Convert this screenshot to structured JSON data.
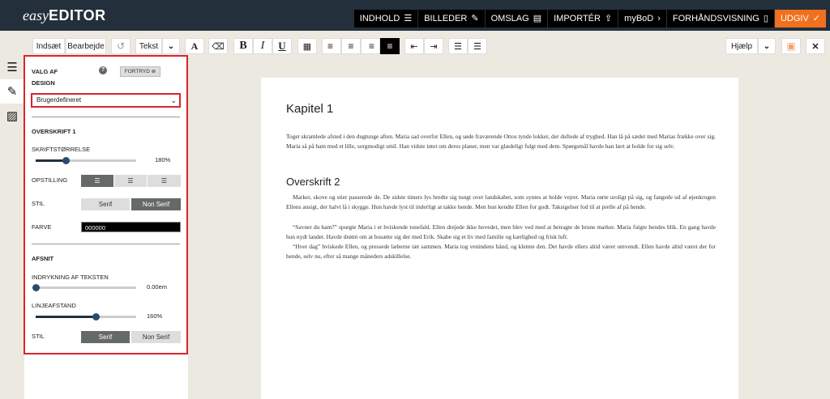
{
  "app": {
    "logo_italic": "easy",
    "logo_bold": "EDITOR"
  },
  "topnav": [
    {
      "label": "INDHOLD",
      "icon": "☰",
      "icon_name": "list-icon"
    },
    {
      "label": "BILLEDER",
      "icon": "✎",
      "icon_name": "paperclip-icon"
    },
    {
      "label": "OMSLAG",
      "icon": "▤",
      "icon_name": "book-icon"
    },
    {
      "label": "IMPORTÉR",
      "icon": "⇪",
      "icon_name": "upload-icon"
    },
    {
      "label": "myBoD",
      "icon": "›",
      "icon_name": "chevron-right-icon"
    },
    {
      "label": "FORHÅNDSVISNING",
      "icon": "▯",
      "icon_name": "mobile-icon"
    },
    {
      "label": "UDGIV",
      "icon": "✓",
      "icon_name": "check-icon"
    }
  ],
  "toolbar": {
    "insert": "Indsæt",
    "edit": "Bearbejde",
    "undo_icon": "↺",
    "text_style": "Tekst",
    "caret": "⌄",
    "font_size_glyph": "A",
    "clear_format_glyph": "⌫",
    "bold": "B",
    "italic": "I",
    "underline": "U",
    "table_glyph": "▦",
    "align_left_glyph": "≡",
    "align_center_glyph": "≡",
    "align_right_glyph": "≡",
    "justify_glyph": "≡",
    "outdent_glyph": "⇤",
    "indent_glyph": "⇥",
    "bullet_glyph": "☰",
    "numbered_glyph": "☰",
    "help": "Hjælp",
    "save_glyph": "▣",
    "close_glyph": "✕"
  },
  "sidebar_icons": [
    {
      "glyph": "☰"
    },
    {
      "glyph": "✎"
    },
    {
      "glyph": "▨"
    }
  ],
  "panel": {
    "design_title_line1": "VALG AF",
    "design_title_line2": "DESIGN",
    "help_glyph": "?",
    "undo_label": "FORTRYD ⊗",
    "design_select": "Brugerdefineret",
    "section_heading1": "OVERSKRIFT 1",
    "font_size_label": "SKRIFTSTØRRELSE",
    "font_size_value": "180%",
    "font_size_level": 0.3,
    "alignment_label": "OPSTILLING",
    "style_label": "STIL",
    "style_options": [
      "Serif",
      "Non Serif"
    ],
    "heading_style_selected": "Non Serif",
    "color_label": "FARVE",
    "color_value": "000000",
    "section_paragraph": "AFSNIT",
    "indent_label": "INDRYKNING AF TEKSTEN",
    "indent_value": "0.00em",
    "indent_level": 0.0,
    "line_spacing_label": "LINJEAFSTAND",
    "line_spacing_value": "160%",
    "line_spacing_level": 0.6,
    "paragraph_style_selected": "Serif"
  },
  "document": {
    "chapter_title": "Kapitel 1",
    "para1": "Toget skramlede afsted i den dugtunge aften. Maria sad overfor Ellen, og søde fraværende Ottos tynde lokker, der duftede af tryghed. Han lå på sædet med Marias frække over sig. Maria så på ham med et lille, sorgmodigt smil. Han vidste intet om deres planer, men var glædeligt fulgt med dem. Spørgsmål havde han lært at holde for sig selv.",
    "heading2": "Overskrift 2",
    "para2": "Marker, skove og stier passerede de. De sidste timers lys bredte sig tungt over landskabet, som syntes at holde vejret. Maria rørte uroligt på sig, og fangede ud af øjenkrogen Ellens ansigt, der halvt lå i skygge. Hun havde lyst til inderligt at takke hende. Men hun kendte Ellen for godt. Taksigelser lod til at prelle af på hende.",
    "para3": "“Savner du ham?” spurgte Maria i et hviskende tonefald. Ellen drejede ikke hovedet, men blev ved med at betragte de brune marker. Maria fulgte hendes blik. En gang havde hun nydt landet. Havde drømt om at bosætte sig der med Erik. Skabe sig et liv med familie og kærlighed og frisk luft.",
    "para4": "“Hver dag” hviskede Ellen, og pressede læberne tæt sammen. Maria tog venindens hånd, og klemte den. Det havde ellers altid været omvendt. Ellen havde altid været der for hende, selv nu, efter så mange måneders adskillelse."
  }
}
